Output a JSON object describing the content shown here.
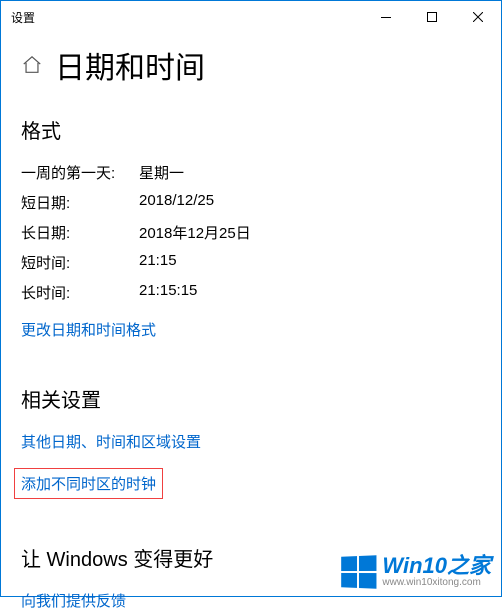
{
  "window": {
    "title": "设置"
  },
  "page": {
    "title": "日期和时间"
  },
  "format_section": {
    "title": "格式",
    "rows": [
      {
        "label": "一周的第一天:",
        "value": "星期一"
      },
      {
        "label": "短日期:",
        "value": "2018/12/25"
      },
      {
        "label": "长日期:",
        "value": "2018年12月25日"
      },
      {
        "label": "短时间:",
        "value": "21:15"
      },
      {
        "label": "长时间:",
        "value": "21:15:15"
      }
    ],
    "change_link": "更改日期和时间格式"
  },
  "related_section": {
    "title": "相关设置",
    "links": {
      "other_region": "其他日期、时间和区域设置",
      "add_clocks": "添加不同时区的时钟"
    }
  },
  "feedback_section": {
    "title": "让 Windows 变得更好",
    "link": "向我们提供反馈"
  },
  "watermark": {
    "main": "Win10之家",
    "sub": "www.win10xitong.com"
  }
}
